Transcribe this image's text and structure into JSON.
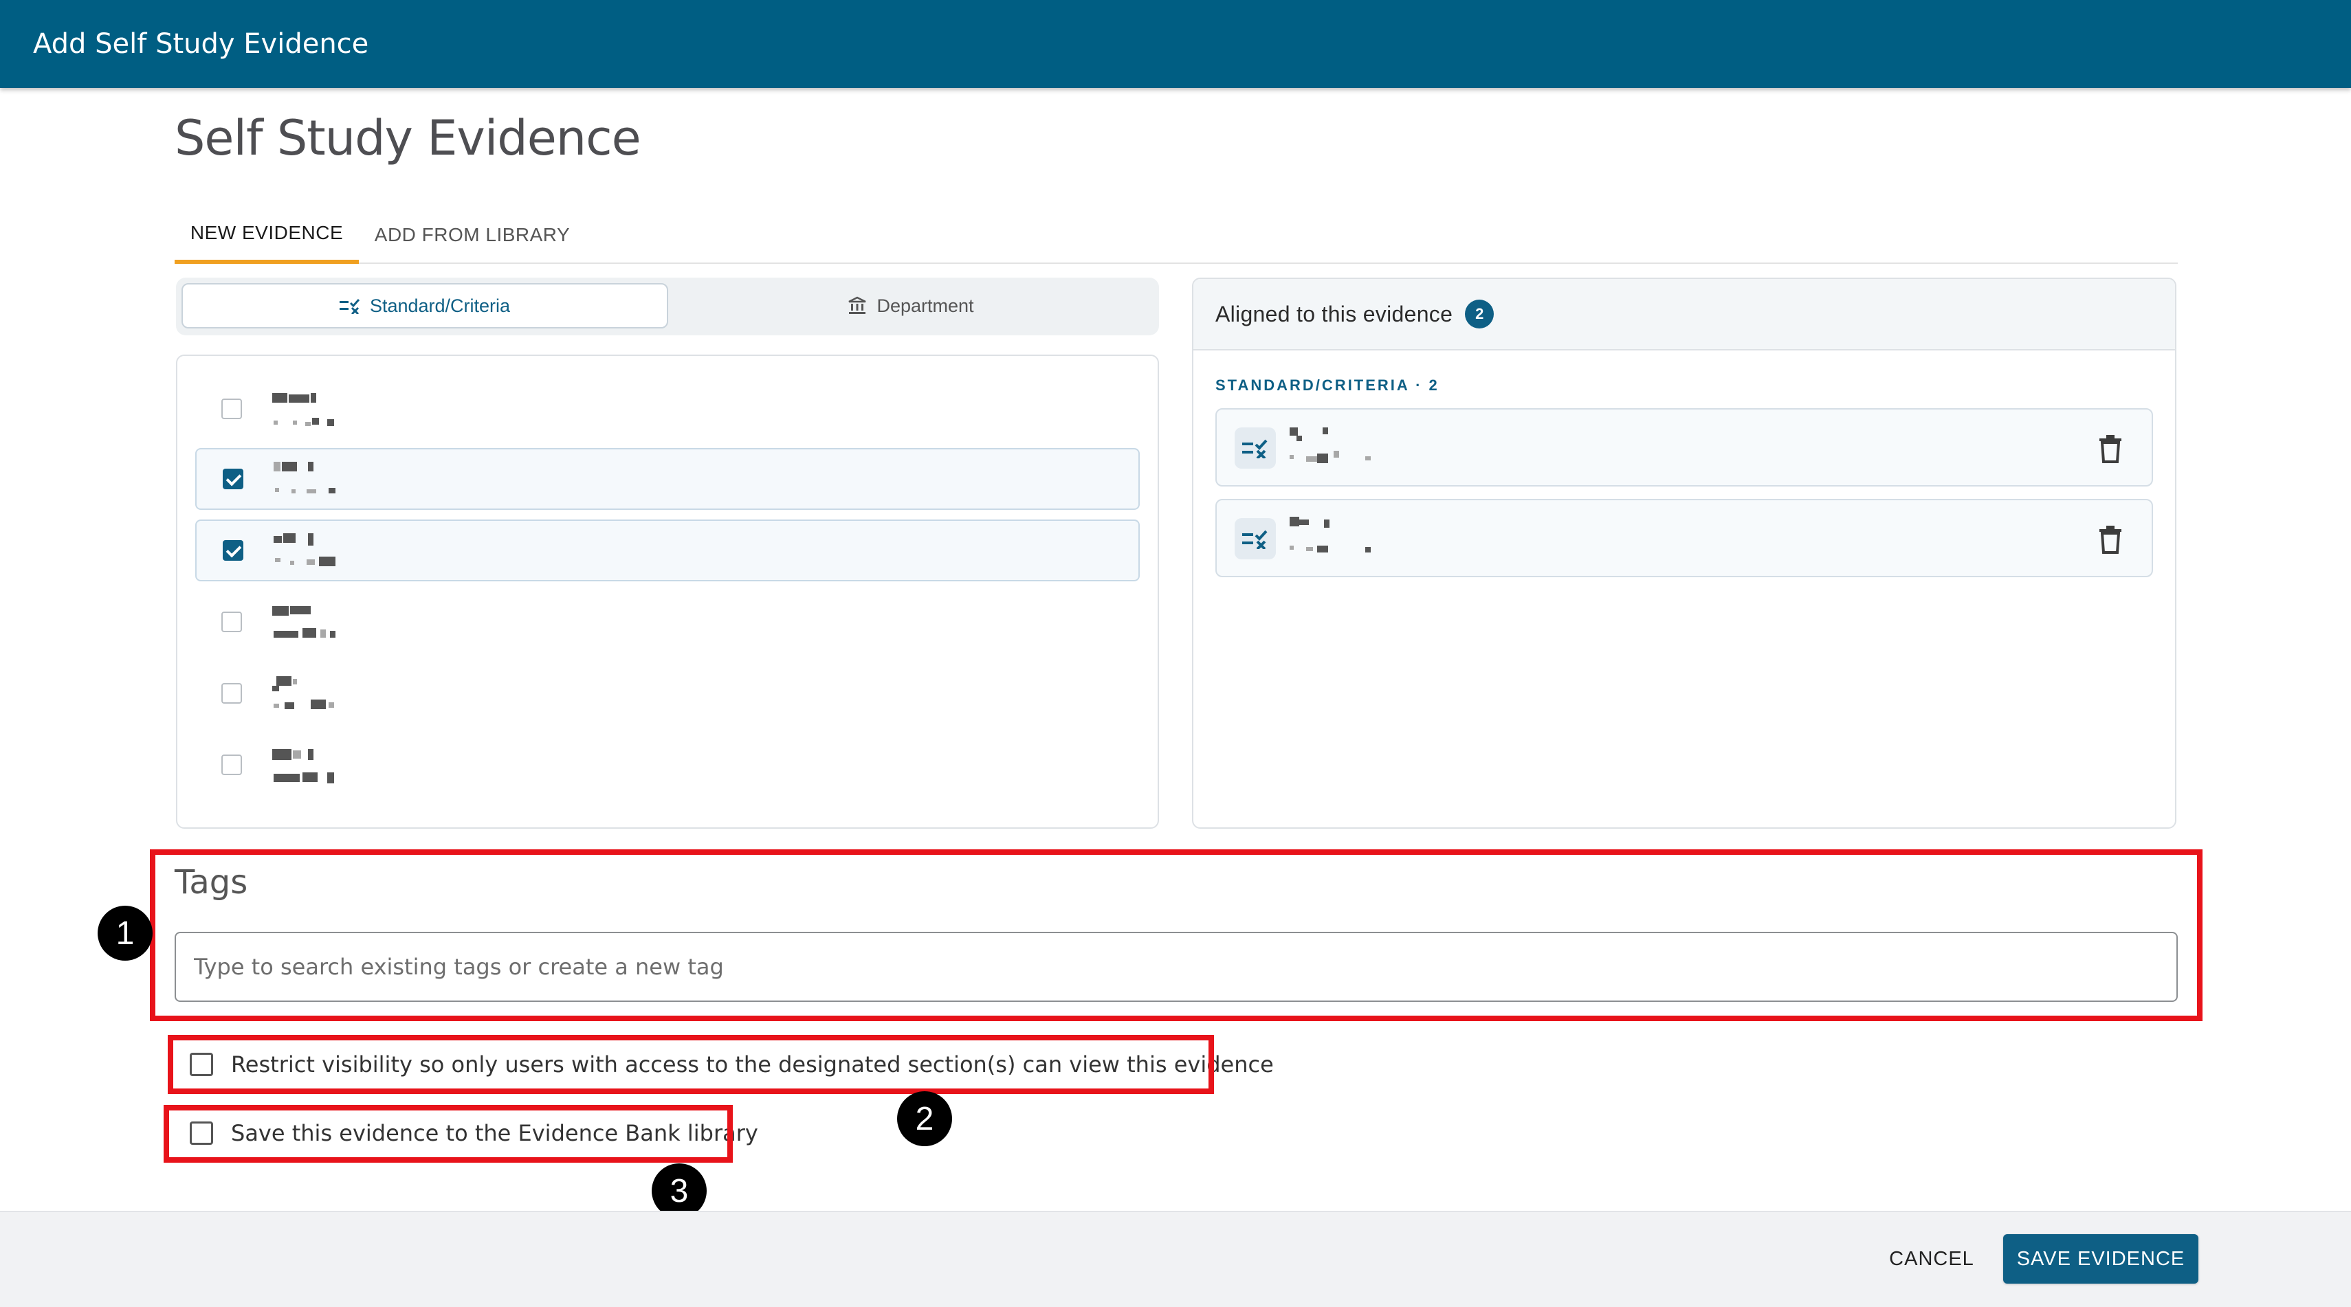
{
  "header": {
    "title": "Add Self Study Evidence"
  },
  "page": {
    "title": "Self Study Evidence"
  },
  "tabs": [
    {
      "label": "NEW EVIDENCE",
      "active": true
    },
    {
      "label": "ADD FROM LIBRARY",
      "active": false
    }
  ],
  "toggle": {
    "standard_label": "Standard/Criteria",
    "department_label": "Department",
    "selected": "Standard/Criteria"
  },
  "criteria_list": {
    "items": [
      {
        "checked": false
      },
      {
        "checked": true
      },
      {
        "checked": true
      },
      {
        "checked": false
      },
      {
        "checked": false
      },
      {
        "checked": false
      }
    ]
  },
  "aligned": {
    "title": "Aligned to this evidence",
    "count": "2",
    "section_label": "STANDARD/CRITERIA · 2",
    "cards": [
      {
        "icon": "criteria-icon"
      },
      {
        "icon": "criteria-icon"
      }
    ]
  },
  "tags": {
    "label": "Tags",
    "placeholder": "Type to search existing tags or create a new tag",
    "value": ""
  },
  "options": {
    "restrict_label": "Restrict visibility so only users with access to the designated section(s) can view this evidence",
    "restrict_checked": false,
    "library_label": "Save this evidence to the Evidence Bank library",
    "library_checked": false
  },
  "annotations": {
    "one": "1",
    "two": "2",
    "three": "3"
  },
  "footer": {
    "cancel_label": "CANCEL",
    "save_label": "SAVE EVIDENCE"
  },
  "colors": {
    "primary": "#005e83",
    "accent": "#0e5f85",
    "tab_indicator": "#f0a020",
    "annotation": "#e8131a"
  }
}
